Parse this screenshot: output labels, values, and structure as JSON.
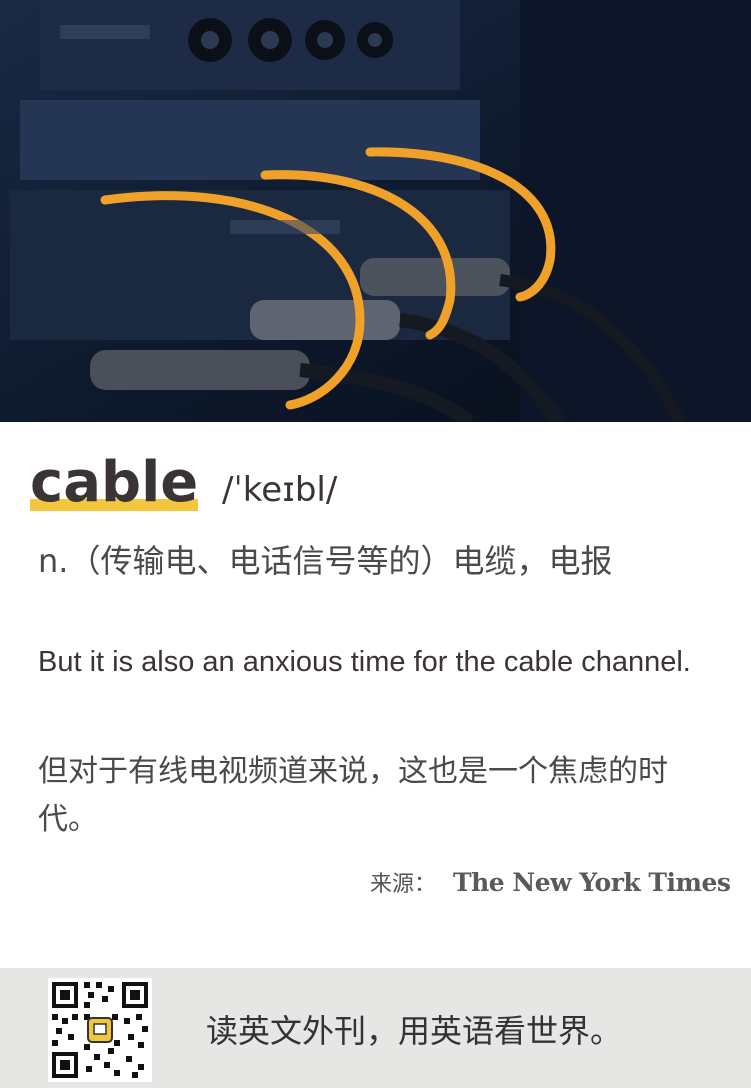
{
  "entry": {
    "word": "cable",
    "phonetic": "/ˈkeɪbl/",
    "definition": "n.（传输电、电话信号等的）电缆，电报"
  },
  "example": {
    "english": "But it is also an anxious time for the cable channel.",
    "chinese": "但对于有线电视频道来说，这也是一个焦虑的时代。"
  },
  "source": {
    "label": "来源：",
    "publication": "The New York Times"
  },
  "footer": {
    "slogan": "读英文外刊，用英语看世界。"
  },
  "colors": {
    "highlight": "#f4c63d",
    "footer_bg": "#e6e6e4",
    "cable_orange": "#f0a12a"
  }
}
